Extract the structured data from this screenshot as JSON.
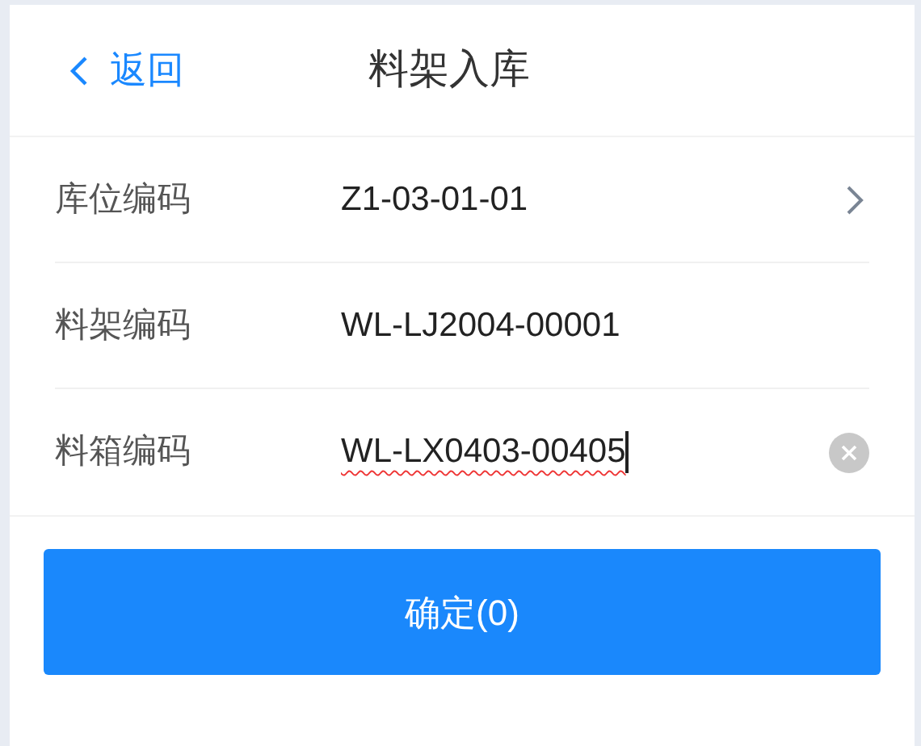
{
  "header": {
    "back": {
      "label": "返回"
    },
    "title": "料架入库"
  },
  "fields": [
    {
      "kind": "select",
      "label": "库位编码",
      "value": "Z1-03-01-01"
    },
    {
      "kind": "text",
      "label": "料架编码",
      "value": "WL-LJ2004-00001"
    },
    {
      "kind": "input",
      "label": "料箱编码",
      "value": "WL-LX0403-00405"
    }
  ],
  "confirm_button": {
    "label": "确定(0)"
  }
}
